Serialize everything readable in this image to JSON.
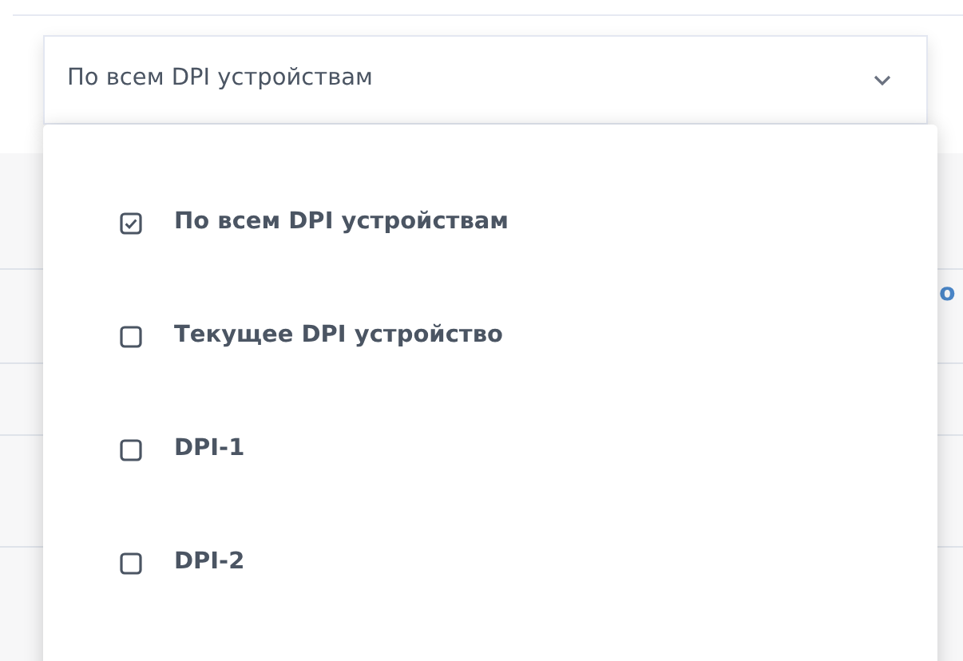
{
  "select": {
    "value": "По всем DPI устройствам",
    "expanded": true
  },
  "options": [
    {
      "label": "По всем DPI устройствам",
      "checked": true
    },
    {
      "label": "Текущее DPI устройство",
      "checked": false
    },
    {
      "label": "DPI-1",
      "checked": false
    },
    {
      "label": "DPI-2",
      "checked": false
    }
  ],
  "background_text": "о"
}
